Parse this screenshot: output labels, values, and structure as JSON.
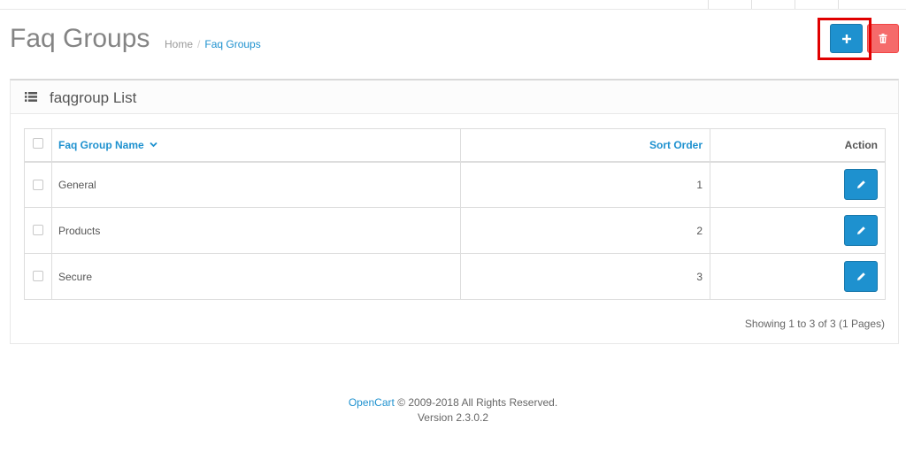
{
  "header": {
    "title": "Faq Groups",
    "breadcrumb": [
      {
        "label": "Home"
      },
      {
        "label": "Faq Groups"
      }
    ],
    "separator": "/"
  },
  "actions": {
    "add_icon": "plus-icon",
    "delete_icon": "trash-icon",
    "add_color": "#1e91cf",
    "delete_color": "#f56b6b",
    "highlight_color": "#e00000"
  },
  "panel": {
    "title": "faqgroup List",
    "icon": "list-icon"
  },
  "table": {
    "columns": {
      "name": "Faq Group Name",
      "sort_order": "Sort Order",
      "action": "Action"
    },
    "sort_indicator": "chevron-down-icon",
    "rows": [
      {
        "name": "General",
        "sort_order": "1"
      },
      {
        "name": "Products",
        "sort_order": "2"
      },
      {
        "name": "Secure",
        "sort_order": "3"
      }
    ],
    "row_action_icon": "pencil-icon"
  },
  "pagination": {
    "text": "Showing 1 to 3 of 3 (1 Pages)"
  },
  "footer": {
    "brand": "OpenCart",
    "copyright": "© 2009-2018 All Rights Reserved.",
    "version": "Version 2.3.0.2"
  }
}
